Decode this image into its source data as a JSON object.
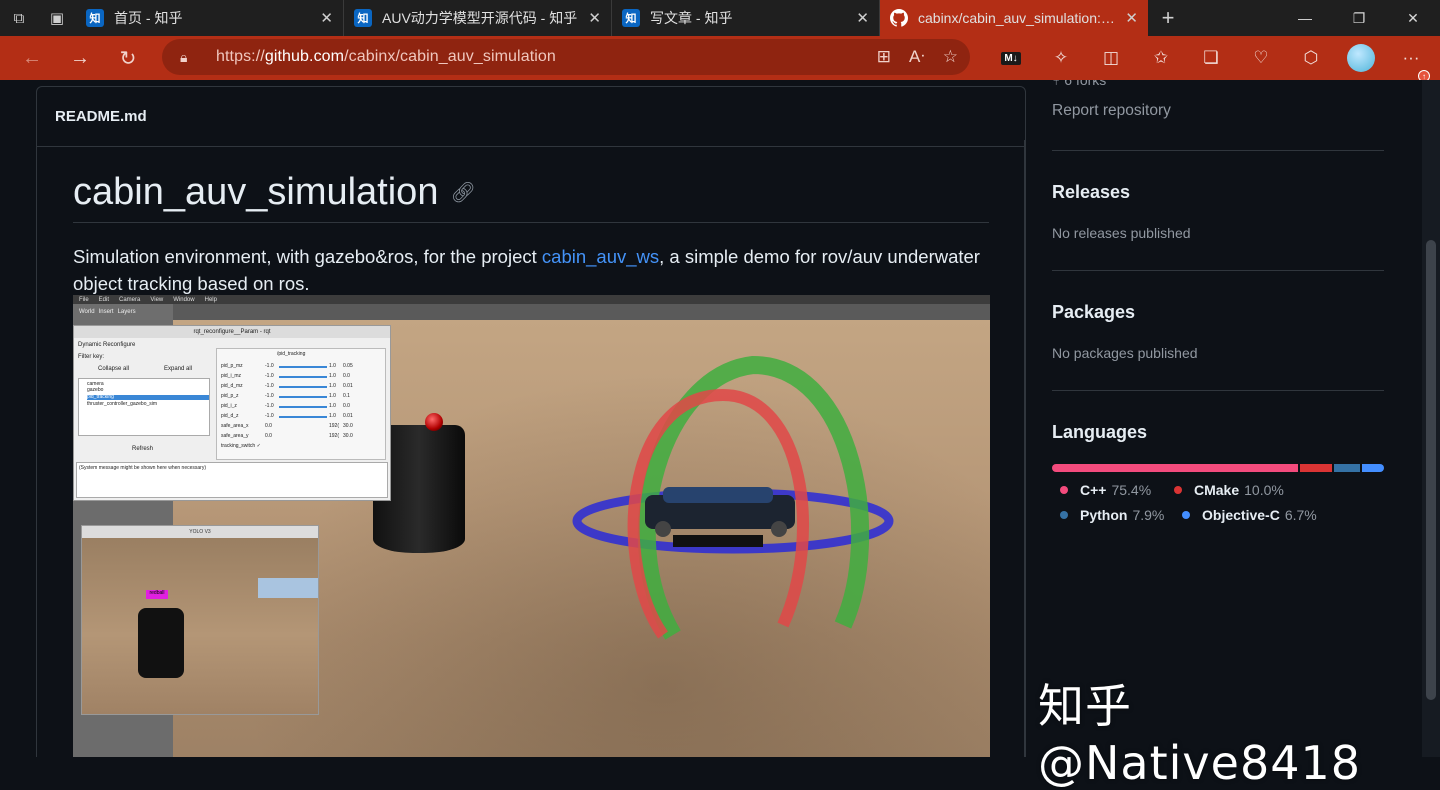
{
  "browser": {
    "tabs": [
      {
        "favicon": "知",
        "title": "首页 - 知乎",
        "close": "✕",
        "active": false
      },
      {
        "favicon": "知",
        "title": "AUV动力学模型开源代码 - 知乎",
        "close": "✕",
        "active": false
      },
      {
        "favicon": "知",
        "title": "写文章 - 知乎",
        "close": "✕",
        "active": false
      },
      {
        "favicon": "github-icon",
        "title": "cabinx/cabin_auv_simulation: simulation environment",
        "close": "✕",
        "active": true
      }
    ],
    "new_tab": "+",
    "window_controls": {
      "minimize": "—",
      "maximize": "❐",
      "close": "✕"
    },
    "address": {
      "prefix": "https://",
      "domain": "github.com",
      "path": "/cabinx/cabin_auv_simulation"
    },
    "colors": {
      "accent": "#b32e15",
      "omnibox": "#8f2410"
    }
  },
  "readme": {
    "filename": "README.md",
    "title": "cabin_auv_simulation",
    "description_before": "Simulation environment, with gazebo&ros, for the project ",
    "description_link": "cabin_auv_ws",
    "description_after": ", a simple demo for rov/auv underwater object tracking based on ros.",
    "screenshot": {
      "gazebo_menu": [
        "File",
        "Edit",
        "Camera",
        "View",
        "Window",
        "Help"
      ],
      "gazebo_tabs": [
        "World",
        "Insert",
        "Layers"
      ],
      "rqt_title": "rqt_reconfigure__Param - rqt",
      "rqt_header": "Dynamic Reconfigure",
      "rqt_filter": "Filter key:",
      "rqt_collapse": "Collapse all",
      "rqt_expand": "Expand all",
      "rqt_nodes": [
        "camera",
        "gazebo",
        "pid_tracking",
        "thruster_controller_gazebo_sim"
      ],
      "rqt_refresh": "Refresh",
      "rqt_panel": "/pid_tracking",
      "rqt_params": [
        {
          "name": "pid_p_mz",
          "min": "-1.0",
          "max": "1.0",
          "value": "0.05"
        },
        {
          "name": "pid_i_mz",
          "min": "-1.0",
          "max": "1.0",
          "value": "0.0"
        },
        {
          "name": "pid_d_mz",
          "min": "-1.0",
          "max": "1.0",
          "value": "0.01"
        },
        {
          "name": "pid_p_z",
          "min": "-1.0",
          "max": "1.0",
          "value": "0.1"
        },
        {
          "name": "pid_i_z",
          "min": "-1.0",
          "max": "1.0",
          "value": "0.0"
        },
        {
          "name": "pid_d_z",
          "min": "-1.0",
          "max": "1.0",
          "value": "0.01"
        },
        {
          "name": "safe_area_x",
          "min": "0.0",
          "max": "192(",
          "value": "30.0"
        },
        {
          "name": "safe_area_y",
          "min": "0.0",
          "max": "192(",
          "value": "30.0"
        }
      ],
      "rqt_switch": "tracking_switch",
      "rqt_switch_value": "✓",
      "rqt_message": "(System message might be shown here when necessary)",
      "yolo_title": "YOLO V3",
      "yolo_label": "redball"
    }
  },
  "sidebar": {
    "forks": "6 forks",
    "report": "Report repository",
    "releases_title": "Releases",
    "releases_empty": "No releases published",
    "packages_title": "Packages",
    "packages_empty": "No packages published",
    "languages_title": "Languages",
    "languages": [
      {
        "name": "C++",
        "pct": "75.4%",
        "share": 75.4,
        "color": "#f34b7d"
      },
      {
        "name": "CMake",
        "pct": "10.0%",
        "share": 10.0,
        "color": "#da3434"
      },
      {
        "name": "Python",
        "pct": "7.9%",
        "share": 7.9,
        "color": "#3572A5"
      },
      {
        "name": "Objective-C",
        "pct": "6.7%",
        "share": 6.7,
        "color": "#438eff"
      }
    ]
  },
  "watermark": "知乎 @Native8418"
}
